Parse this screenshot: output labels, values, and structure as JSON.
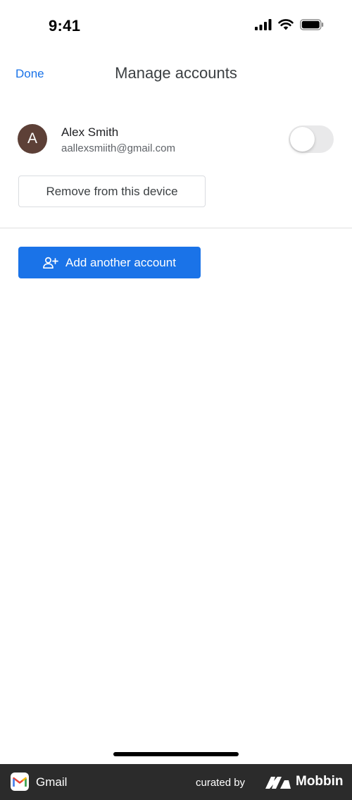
{
  "status_bar": {
    "time": "9:41"
  },
  "nav": {
    "done_label": "Done",
    "title": "Manage accounts"
  },
  "account": {
    "initial": "A",
    "name": "Alex Smith",
    "email": "aallexsmiith@gmail.com",
    "avatar_color": "#5d4037",
    "toggle_on": false
  },
  "actions": {
    "remove_label": "Remove from this device",
    "add_label": "Add another account"
  },
  "colors": {
    "accent": "#1a73e8"
  },
  "footer": {
    "app_name": "Gmail",
    "curated_by": "curated by",
    "brand": "Mobbin"
  }
}
